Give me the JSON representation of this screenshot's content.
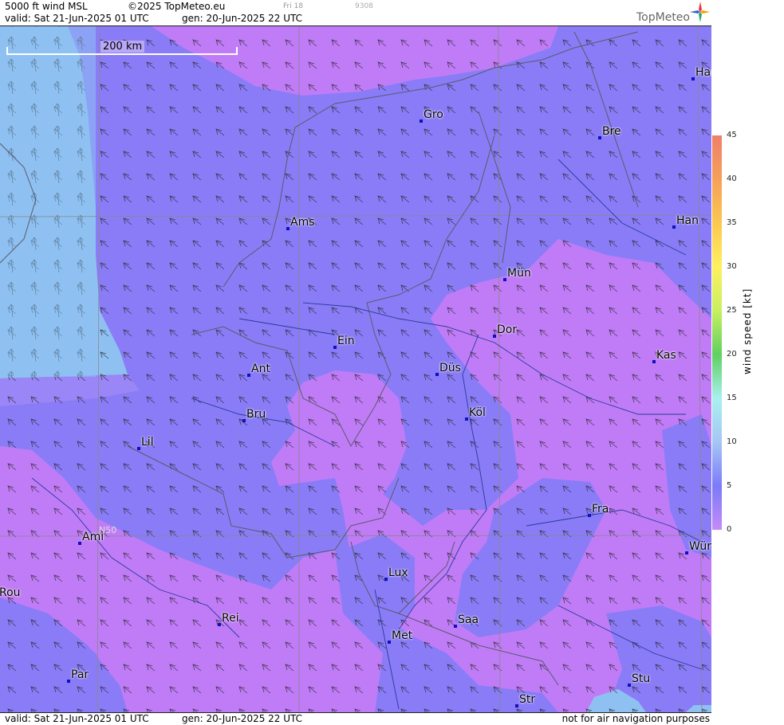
{
  "header": {
    "product": "5000 ft wind MSL",
    "copyright": "©2025 TopMeteo.eu",
    "valid": "valid:  Sat  21-Jun-2025  01 UTC",
    "gen": "gen: 20-Jun-2025 22 UTC",
    "timeline_day": "Fri 18",
    "timeline_code": "9308",
    "logo_text": "TopMeteo"
  },
  "footer": {
    "valid": "valid:  Sat  21-Jun-2025  01 UTC",
    "gen": "gen: 20-Jun-2025 22 UTC",
    "disclaimer": "not for air navigation purposes"
  },
  "scale_bar": {
    "label": "200 km"
  },
  "grid_label": "N50",
  "cities": [
    {
      "name": "Ham"
    },
    {
      "name": "Gro"
    },
    {
      "name": "Bre"
    },
    {
      "name": "Ams"
    },
    {
      "name": "Han"
    },
    {
      "name": "Mün"
    },
    {
      "name": "Dor"
    },
    {
      "name": "Ein"
    },
    {
      "name": "Kas"
    },
    {
      "name": "Ant"
    },
    {
      "name": "Düs"
    },
    {
      "name": "Bru"
    },
    {
      "name": "Köl"
    },
    {
      "name": "Lil"
    },
    {
      "name": "Fra"
    },
    {
      "name": "Ami"
    },
    {
      "name": "Wür"
    },
    {
      "name": "Lux"
    },
    {
      "name": "Rou"
    },
    {
      "name": "Saa"
    },
    {
      "name": "Rei"
    },
    {
      "name": "Met"
    },
    {
      "name": "Par"
    },
    {
      "name": "Stu"
    },
    {
      "name": "Str"
    }
  ],
  "legend": {
    "title": "wind  speed  [kt]",
    "ticks": [
      "45",
      "40",
      "35",
      "30",
      "25",
      "20",
      "15",
      "10",
      "5",
      "0"
    ],
    "colors": [
      "#f07f6a",
      "#f5a05a",
      "#fbc850",
      "#fff060",
      "#c8f060",
      "#5fd060",
      "#a8f0f0",
      "#a6c6f4",
      "#7b7bf8",
      "#c58bf7"
    ]
  },
  "colors": {
    "purple": "#c07cf7",
    "violet": "#8a7cf7",
    "lightblue": "#8ec1f2",
    "city": "#1010c0",
    "river": "#2a3a9a"
  }
}
